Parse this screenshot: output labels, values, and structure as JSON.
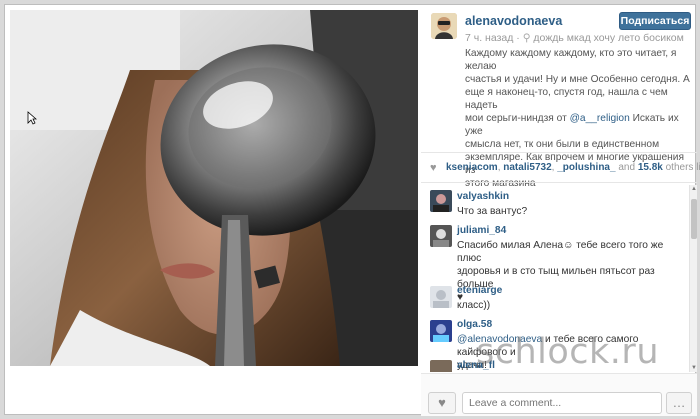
{
  "post": {
    "username": "alenavodonaeva",
    "follow_label": "Подписаться",
    "time_ago": "7 ч. назад",
    "location": "дождь мкад хочу лето босиком",
    "caption_lines": [
      "Каждому каждому каждому, кто это читает, я желаю",
      "счастья и удачи! Ну и мне  Особенно сегодня. А",
      "еще я наконец-то, спустя год, нашла с чем надеть",
      "мои серьги-ниндзя от ",
      "смысла нет, тк они были в единственном",
      "экземпляре. Как впрочем и многие украшения из",
      "этого магазина "
    ],
    "caption_mention": "@a__religion",
    "caption_after_mention": " Искать их уже"
  },
  "likes": {
    "users": [
      "kseniacom",
      "natali5732",
      "_polushina_"
    ],
    "and_word": "and",
    "count": "15.8k",
    "others_text": "others like this."
  },
  "comments": [
    {
      "user": "valyashkin",
      "lines": [
        "Что за вантус?"
      ]
    },
    {
      "user": "juliami_84",
      "lines": [
        "Спасибо милая Алена☺ тебе всего того же плюс",
        "здоровья и в сто тыщ мильен пятьсот раз больше ",
        "♥"
      ]
    },
    {
      "user": "eteniarge",
      "lines": [
        "класс))"
      ]
    },
    {
      "user": "olga.58",
      "mention": "@alenavodonaeva",
      "lines": [
        " и тебе всего самого кайфового и",
        "удачи!"
      ]
    },
    {
      "user": "alena_fl",
      "lines": [
        ""
      ]
    }
  ],
  "footer": {
    "comment_placeholder": "Leave a comment...",
    "more_label": "…",
    "like_icon": "♥"
  },
  "watermark": "schlock.ru",
  "colors": {
    "accent": "#3f729b",
    "link": "#2e5e86"
  }
}
